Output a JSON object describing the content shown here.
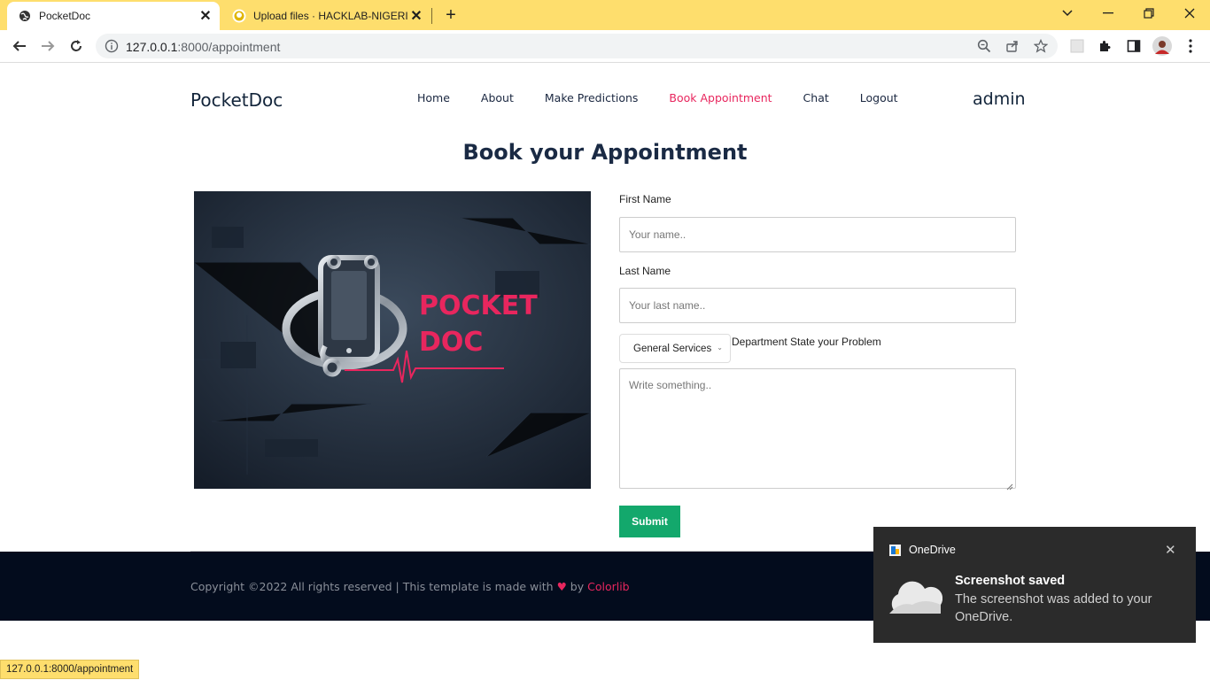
{
  "browser": {
    "tabs": [
      {
        "title": "PocketDoc",
        "active": true,
        "icon": "globe-icon"
      },
      {
        "title": "Upload files · HACKLAB-NIGERIA",
        "active": false,
        "icon": "github-icon"
      }
    ],
    "url_host": "127.0.0.1",
    "url_path": ":8000/appointment",
    "status_url": "127.0.0.1:8000/appointment"
  },
  "site": {
    "brand": "PocketDoc",
    "nav": [
      {
        "label": "Home",
        "active": false
      },
      {
        "label": "About",
        "active": false
      },
      {
        "label": "Make Predictions",
        "active": false
      },
      {
        "label": "Book Appointment",
        "active": true
      },
      {
        "label": "Chat",
        "active": false
      },
      {
        "label": "Logout",
        "active": false
      }
    ],
    "user": "admin"
  },
  "main": {
    "heading": "Book your Appointment",
    "hero": {
      "line1": "POCKET",
      "line2": "DOC"
    },
    "form": {
      "first_name_label": "First Name",
      "first_name_placeholder": "Your name..",
      "last_name_label": "Last Name",
      "last_name_placeholder": "Your last name..",
      "department_value": "General Services",
      "department_label": "Department State your Problem",
      "problem_placeholder": "Write something..",
      "submit_label": "Submit"
    }
  },
  "footer": {
    "copyright": "Copyright ©2022 All rights reserved | This template is made with",
    "by": "by",
    "author": "Colorlib"
  },
  "toast": {
    "app": "OneDrive",
    "title": "Screenshot saved",
    "message": "The screenshot was added to your OneDrive."
  },
  "colors": {
    "accent": "#e8265e",
    "submit": "#13a86c",
    "tabbar": "#fede6d",
    "footer": "#030c1d"
  }
}
